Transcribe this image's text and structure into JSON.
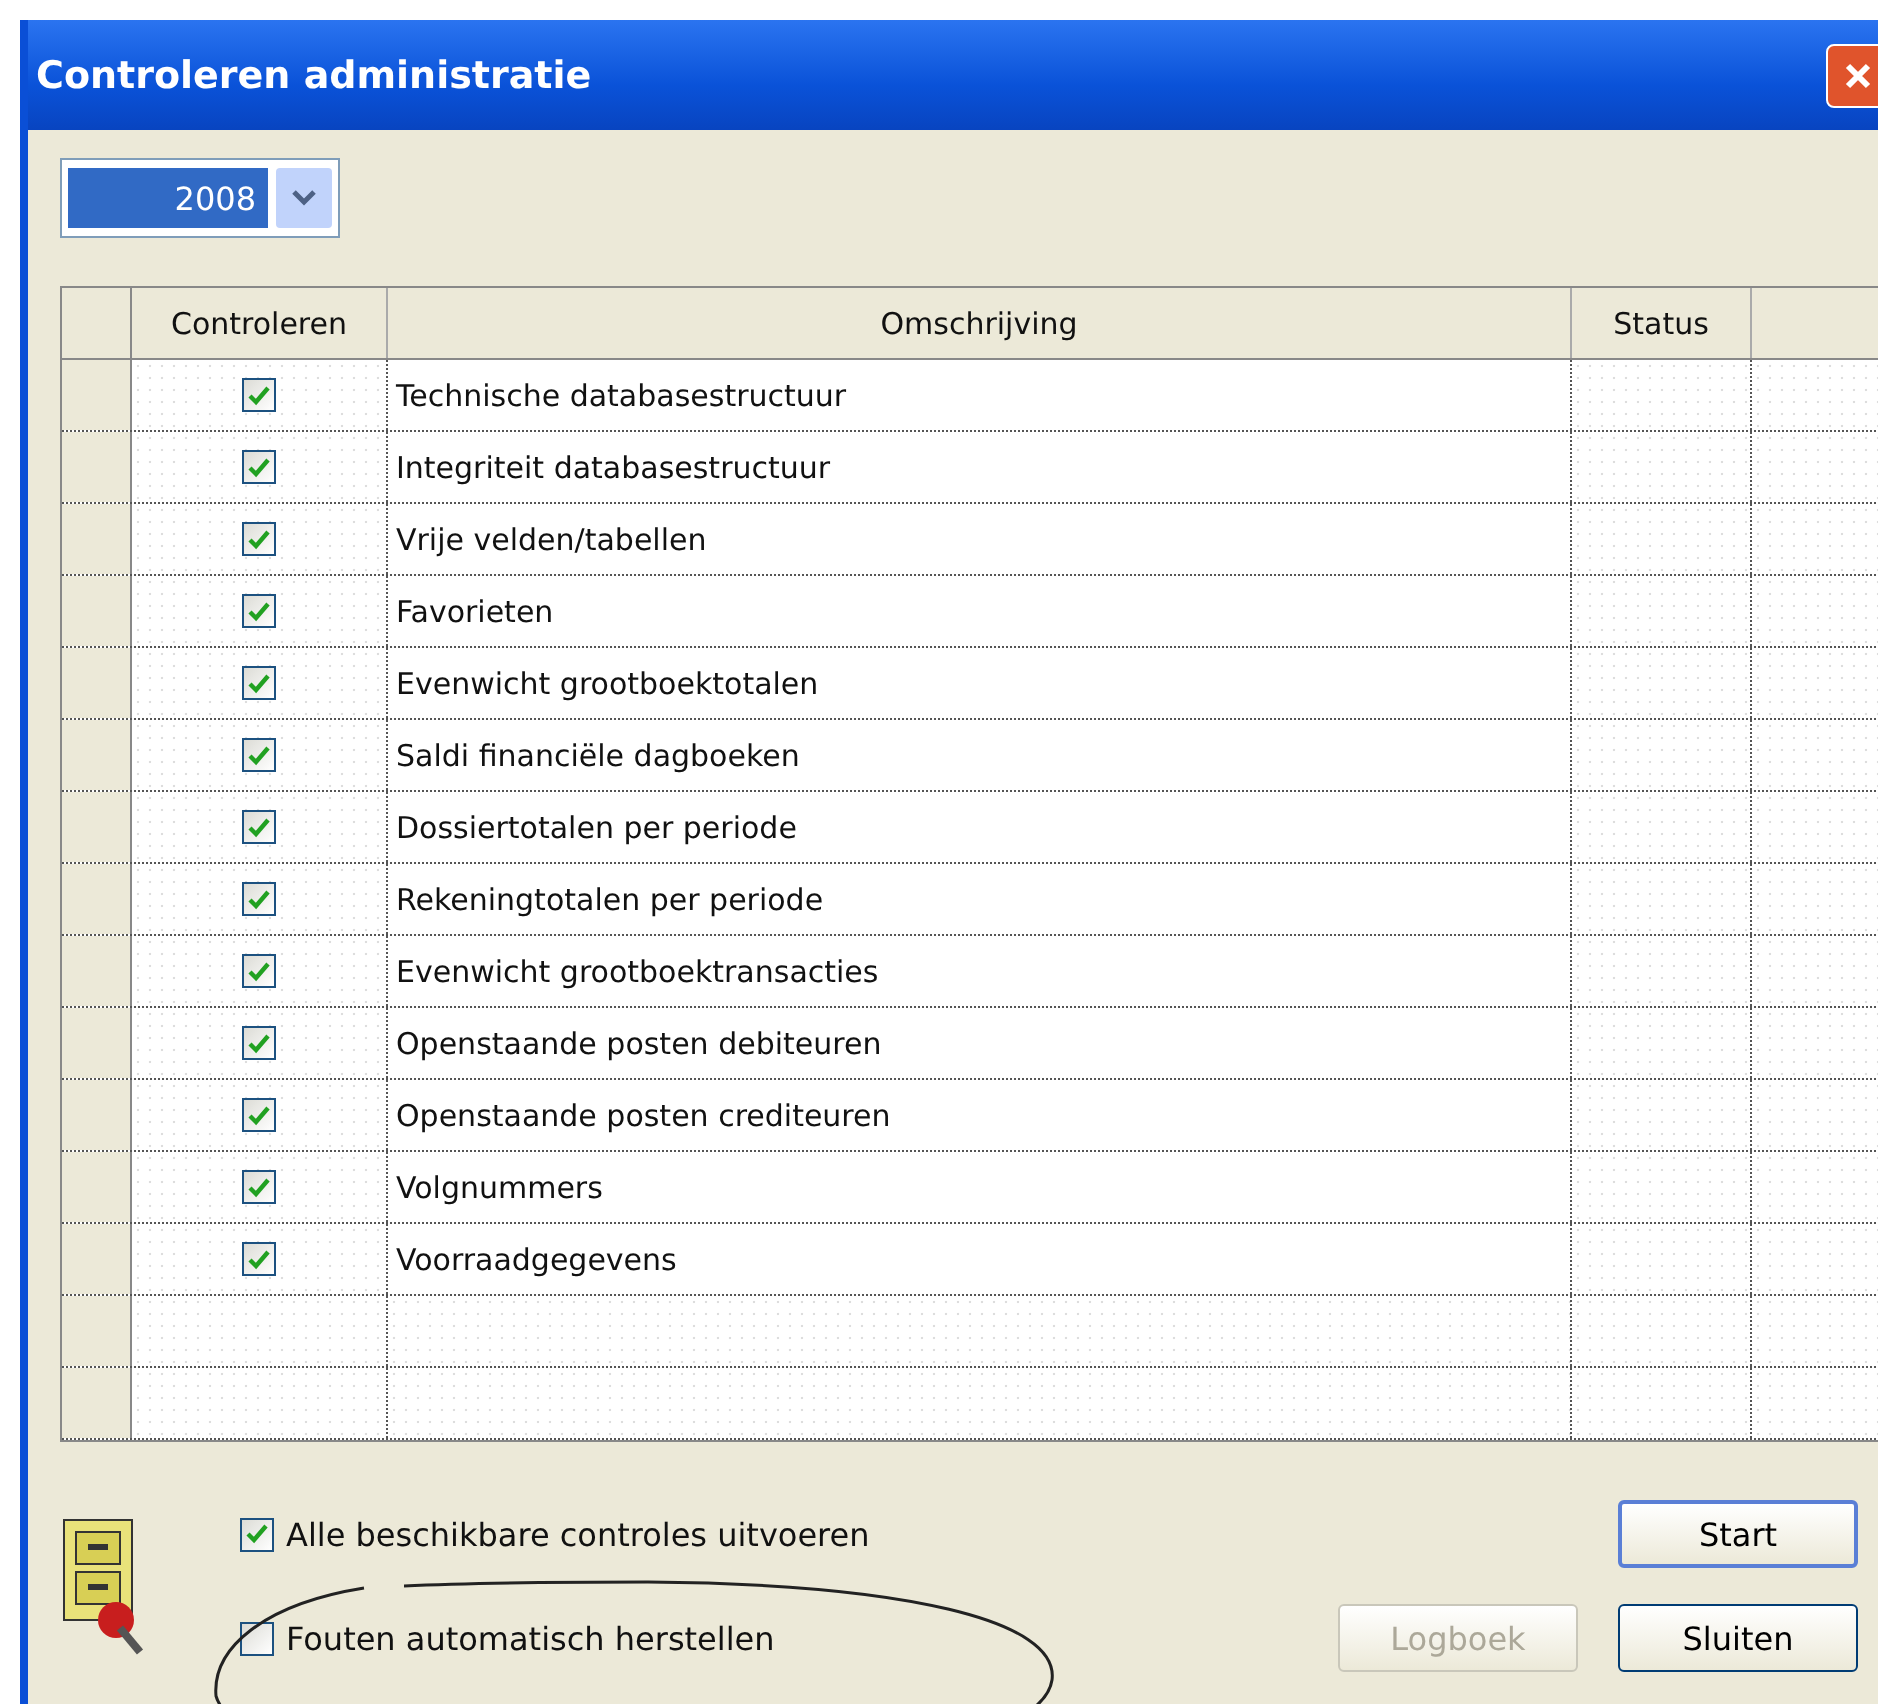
{
  "window": {
    "title": "Controleren administratie"
  },
  "year": {
    "value": "2008"
  },
  "table": {
    "columns": [
      "Controleren",
      "Omschrijving",
      "Status"
    ],
    "rows": [
      {
        "checked": true,
        "description": "Technische databasestructuur"
      },
      {
        "checked": true,
        "description": "Integriteit databasestructuur"
      },
      {
        "checked": true,
        "description": "Vrije velden/tabellen"
      },
      {
        "checked": true,
        "description": "Favorieten"
      },
      {
        "checked": true,
        "description": "Evenwicht grootboektotalen"
      },
      {
        "checked": true,
        "description": "Saldi financiële dagboeken"
      },
      {
        "checked": true,
        "description": "Dossiertotalen per periode"
      },
      {
        "checked": true,
        "description": "Rekeningtotalen per periode"
      },
      {
        "checked": true,
        "description": "Evenwicht grootboektransacties"
      },
      {
        "checked": true,
        "description": "Openstaande posten debiteuren"
      },
      {
        "checked": true,
        "description": "Openstaande posten crediteuren"
      },
      {
        "checked": true,
        "description": "Volgnummers"
      },
      {
        "checked": true,
        "description": "Voorraadgegevens"
      }
    ]
  },
  "options": [
    {
      "label": "Alle beschikbare controles uitvoeren",
      "checked": true
    },
    {
      "label": "Fouten automatisch herstellen",
      "checked": false
    }
  ],
  "buttons": [
    {
      "label": "Start",
      "disabled": false,
      "default": true,
      "kind": "right"
    },
    {
      "label": "Logboek",
      "disabled": true,
      "default": false,
      "kind": "left"
    },
    {
      "label": "Sluiten",
      "disabled": false,
      "default": false,
      "kind": "right"
    }
  ]
}
